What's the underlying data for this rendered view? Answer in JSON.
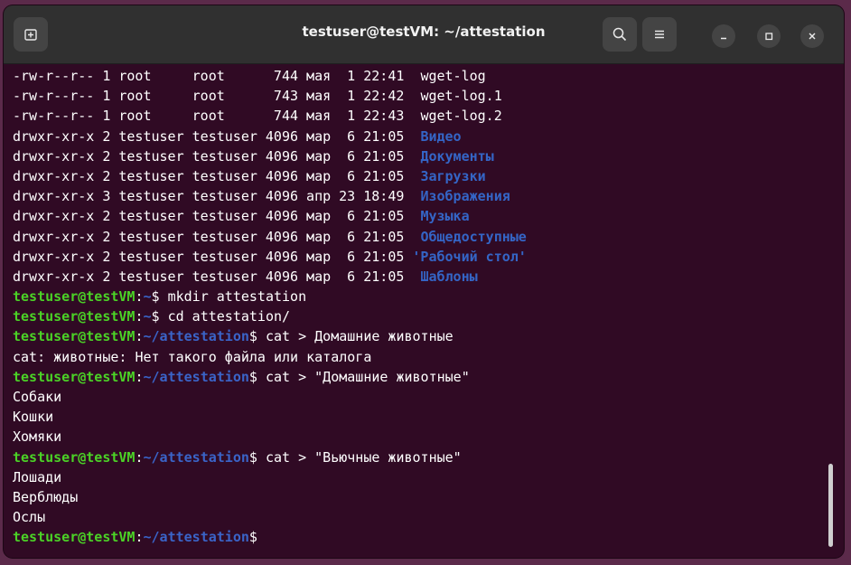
{
  "window": {
    "title": "testuser@testVM: ~/attestation"
  },
  "icons": {
    "new_tab": "new-tab-icon",
    "search": "search-icon",
    "menu": "hamburger-menu-icon",
    "minimize": "minimize-icon",
    "maximize": "maximize-icon",
    "close": "close-icon"
  },
  "colors": {
    "terminal_bg": "#300a24",
    "prompt_user": "#4bd326",
    "prompt_path": "#3a64c8",
    "directory": "#3465c6",
    "text": "#ffffff",
    "titlebar": "#303030"
  },
  "listing": [
    {
      "perm": "-rw-r--r--",
      "links": "1",
      "owner": "root",
      "group": "root",
      "size": "744",
      "month": "мая",
      "day": "1",
      "time": "22:41",
      "name": "wget-log",
      "is_dir": false
    },
    {
      "perm": "-rw-r--r--",
      "links": "1",
      "owner": "root",
      "group": "root",
      "size": "743",
      "month": "мая",
      "day": "1",
      "time": "22:42",
      "name": "wget-log.1",
      "is_dir": false
    },
    {
      "perm": "-rw-r--r--",
      "links": "1",
      "owner": "root",
      "group": "root",
      "size": "744",
      "month": "мая",
      "day": "1",
      "time": "22:43",
      "name": "wget-log.2",
      "is_dir": false
    },
    {
      "perm": "drwxr-xr-x",
      "links": "2",
      "owner": "testuser",
      "group": "testuser",
      "size": "4096",
      "month": "мар",
      "day": "6",
      "time": "21:05",
      "name": "Видео",
      "is_dir": true
    },
    {
      "perm": "drwxr-xr-x",
      "links": "2",
      "owner": "testuser",
      "group": "testuser",
      "size": "4096",
      "month": "мар",
      "day": "6",
      "time": "21:05",
      "name": "Документы",
      "is_dir": true
    },
    {
      "perm": "drwxr-xr-x",
      "links": "2",
      "owner": "testuser",
      "group": "testuser",
      "size": "4096",
      "month": "мар",
      "day": "6",
      "time": "21:05",
      "name": "Загрузки",
      "is_dir": true
    },
    {
      "perm": "drwxr-xr-x",
      "links": "3",
      "owner": "testuser",
      "group": "testuser",
      "size": "4096",
      "month": "апр",
      "day": "23",
      "time": "18:49",
      "name": "Изображения",
      "is_dir": true
    },
    {
      "perm": "drwxr-xr-x",
      "links": "2",
      "owner": "testuser",
      "group": "testuser",
      "size": "4096",
      "month": "мар",
      "day": "6",
      "time": "21:05",
      "name": "Музыка",
      "is_dir": true
    },
    {
      "perm": "drwxr-xr-x",
      "links": "2",
      "owner": "testuser",
      "group": "testuser",
      "size": "4096",
      "month": "мар",
      "day": "6",
      "time": "21:05",
      "name": "Общедоступные",
      "is_dir": true
    },
    {
      "perm": "drwxr-xr-x",
      "links": "2",
      "owner": "testuser",
      "group": "testuser",
      "size": "4096",
      "month": "мар",
      "day": "6",
      "time": "21:05",
      "name": "'Рабочий стол'",
      "is_dir": true
    },
    {
      "perm": "drwxr-xr-x",
      "links": "2",
      "owner": "testuser",
      "group": "testuser",
      "size": "4096",
      "month": "мар",
      "day": "6",
      "time": "21:05",
      "name": "Шаблоны",
      "is_dir": true
    }
  ],
  "session": [
    {
      "type": "prompt",
      "user": "testuser@testVM",
      "sep": ":",
      "path": "~",
      "sym": "$",
      "cmd": " mkdir attestation"
    },
    {
      "type": "prompt",
      "user": "testuser@testVM",
      "sep": ":",
      "path": "~",
      "sym": "$",
      "cmd": " cd attestation/"
    },
    {
      "type": "prompt",
      "user": "testuser@testVM",
      "sep": ":",
      "path": "~/attestation",
      "sym": "$",
      "cmd": " cat > Домашние животные"
    },
    {
      "type": "output",
      "text": "cat: животные: Нет такого файла или каталога"
    },
    {
      "type": "prompt",
      "user": "testuser@testVM",
      "sep": ":",
      "path": "~/attestation",
      "sym": "$",
      "cmd": " cat > \"Домашние животные\""
    },
    {
      "type": "output",
      "text": "Собаки"
    },
    {
      "type": "output",
      "text": "Кошки"
    },
    {
      "type": "output",
      "text": "Хомяки"
    },
    {
      "type": "prompt",
      "user": "testuser@testVM",
      "sep": ":",
      "path": "~/attestation",
      "sym": "$",
      "cmd": " cat > \"Вьючные животные\""
    },
    {
      "type": "output",
      "text": "Лошади"
    },
    {
      "type": "output",
      "text": "Верблюды"
    },
    {
      "type": "output",
      "text": "Ослы"
    },
    {
      "type": "prompt",
      "user": "testuser@testVM",
      "sep": ":",
      "path": "~/attestation",
      "sym": "$",
      "cmd": ""
    }
  ]
}
